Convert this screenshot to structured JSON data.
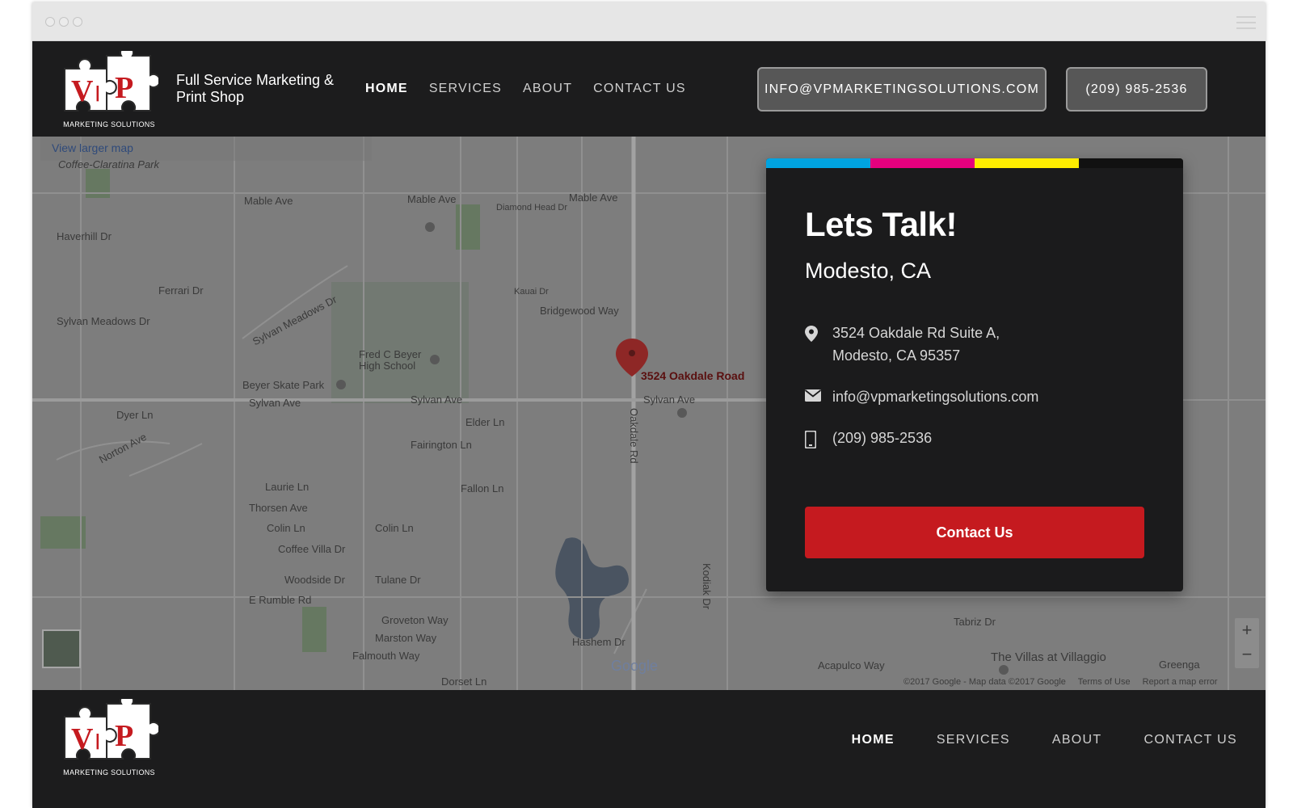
{
  "header": {
    "logo_caption": "MARKETING SOLUTIONS",
    "tagline": "Full Service Marketing & Print Shop",
    "nav": [
      "HOME",
      "SERVICES",
      "ABOUT",
      "CONTACT US"
    ],
    "email_button": "INFO@VPMARKETINGSOLUTIONS.COM",
    "phone_button": "(209) 985-2536"
  },
  "map": {
    "view_larger": "View larger map",
    "pin_label": "3524 Oakdale Road",
    "google": "Google",
    "copyright": "©2017 Google - Map data ©2017 Google",
    "terms": "Terms of Use",
    "report": "Report a map error",
    "streets": [
      "Coffee-Claratina Park",
      "Mable Ave",
      "Mable Ave",
      "Mable Ave",
      "Diamond Head Dr",
      "Haverhill Dr",
      "Ferrari Dr",
      "Sylvan Meadows Dr",
      "Sylvan Meadows Dr",
      "Kauai Dr",
      "Bridgewood Way",
      "Fred C Beyer High School",
      "Beyer Skate Park",
      "Sylvan Ave",
      "Sylvan Ave",
      "Sylvan Ave",
      "Dyer Ln",
      "Norton Ave",
      "Elder Ln",
      "Fairington Ln",
      "Fallon Ln",
      "Laurie Ln",
      "Thorsen Ave",
      "Colin Ln",
      "Colin Ln",
      "Coffee Villa Dr",
      "Woodside Dr",
      "Tulane Dr",
      "E Rumble Rd",
      "Groveton Way",
      "Marston Way",
      "Falmouth Way",
      "Dorset Ln",
      "Hashem Dr",
      "Kodiak Dr",
      "Tabriz Dr",
      "The Villas at Villaggio",
      "Acapulco Way",
      "Greenga",
      "Oakdale Rd"
    ]
  },
  "card": {
    "stripe_colors": [
      "#00a3e0",
      "#e6007e",
      "#ffec00",
      "#111111"
    ],
    "title": "Lets Talk!",
    "city": "Modesto, CA",
    "address_line1": "3524 Oakdale Rd Suite A,",
    "address_line2": "Modesto, CA 95357",
    "email": "info@vpmarketingsolutions.com",
    "phone": "(209) 985-2536",
    "cta": "Contact Us"
  },
  "footer": {
    "logo_caption": "MARKETING SOLUTIONS",
    "nav": [
      "HOME",
      "SERVICES",
      "ABOUT",
      "CONTACT US"
    ]
  },
  "colors": {
    "accent_red": "#c51a1f",
    "header_bg": "#1c1c1d"
  }
}
